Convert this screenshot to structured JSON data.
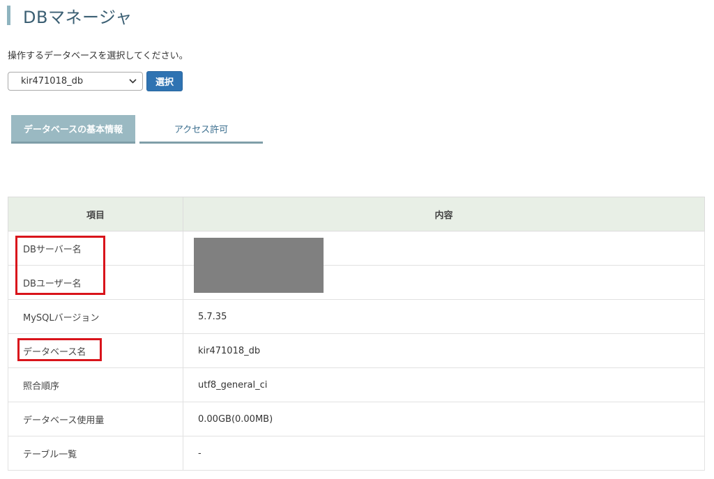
{
  "header": {
    "title": "DBマネージャ"
  },
  "instruction": "操作するデータベースを選択してください。",
  "db_select": {
    "value": "kir471018_db"
  },
  "select_button": {
    "label": "選択"
  },
  "tabs": [
    {
      "label": "データベースの基本情報",
      "active": true
    },
    {
      "label": "アクセス許可",
      "active": false
    }
  ],
  "table": {
    "headers": [
      "項目",
      "内容"
    ],
    "rows": [
      {
        "label": "DBサーバー名",
        "value": ""
      },
      {
        "label": "DBユーザー名",
        "value": ""
      },
      {
        "label": "MySQLバージョン",
        "value": "5.7.35"
      },
      {
        "label": "データベース名",
        "value": "kir471018_db"
      },
      {
        "label": "照合順序",
        "value": "utf8_general_ci"
      },
      {
        "label": "データベース使用量",
        "value": "0.00GB(0.00MB)"
      },
      {
        "label": "テーブル一覧",
        "value": "-"
      }
    ]
  },
  "colors": {
    "accent_bar": "#8fb4bf",
    "button_blue": "#2f73b2",
    "active_tab": "#9ab9c2",
    "table_header_bg": "#e8efe6",
    "highlight_red": "#d9141b",
    "redaction_gray": "#808080"
  }
}
